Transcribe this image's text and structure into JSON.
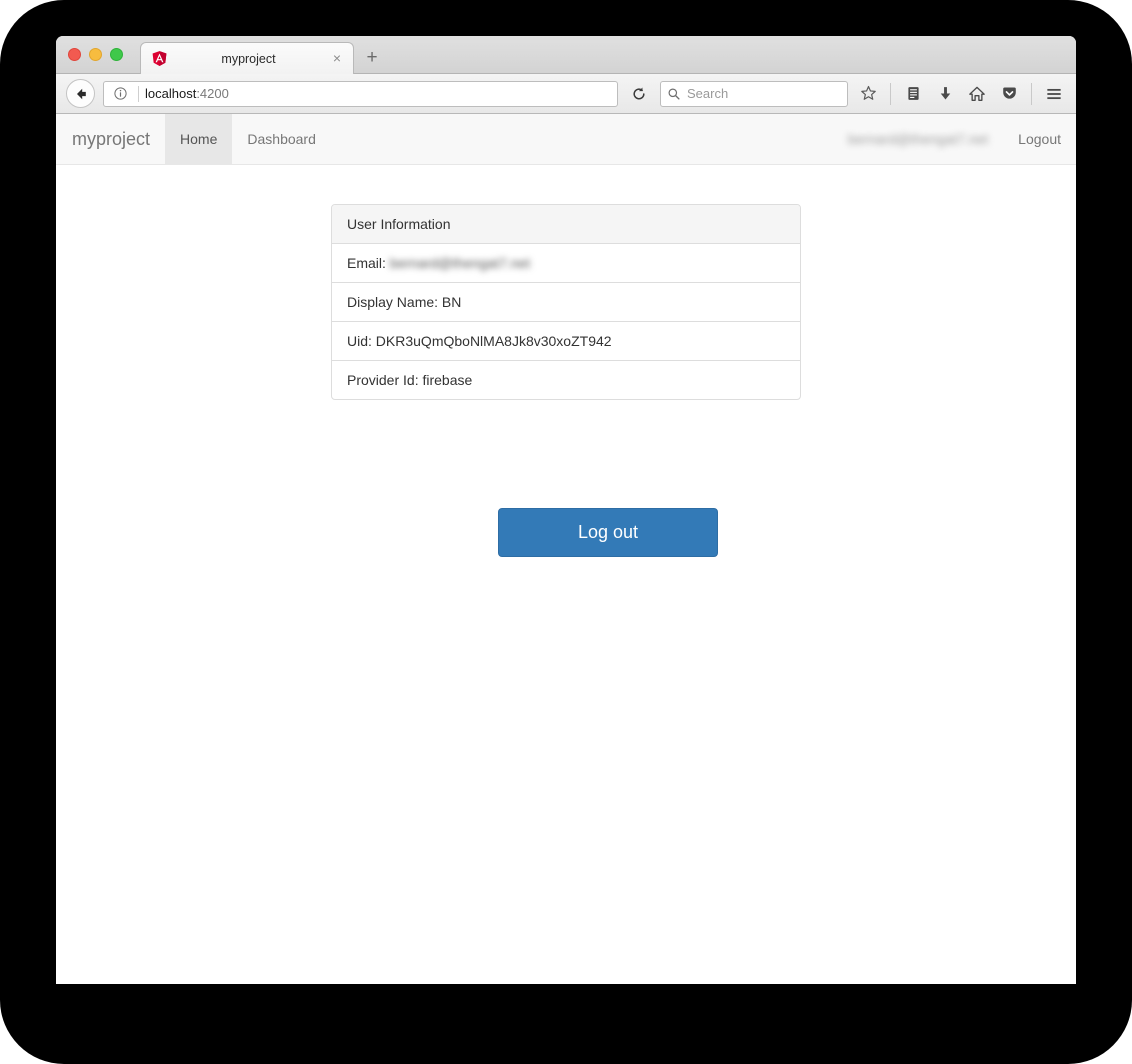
{
  "browser": {
    "traffic_lights": [
      "close",
      "minimize",
      "zoom"
    ],
    "tab": {
      "title": "myproject",
      "favicon": "angular-logo-icon",
      "close_label": "×"
    },
    "new_tab_label": "+",
    "back_label": "←",
    "url": {
      "host": "localhost",
      "port": ":4200"
    },
    "search": {
      "placeholder": "Search"
    },
    "toolbar_icons": [
      "bookmark-star-icon",
      "reader-list-icon",
      "downloads-icon",
      "home-icon",
      "pocket-icon",
      "menu-hamburger-icon"
    ]
  },
  "app": {
    "brand": "myproject",
    "nav_items": [
      {
        "label": "Home",
        "active": true
      },
      {
        "label": "Dashboard",
        "active": false
      }
    ],
    "navbar_user_email": "bernard@thengat7.net",
    "logout_link": "Logout",
    "panel": {
      "heading": "User Information",
      "rows": [
        {
          "label": "Email:",
          "value": "bernard@thengat7.net",
          "blurred": true
        },
        {
          "label": "Display Name:",
          "value": "BN",
          "blurred": false
        },
        {
          "label": "Uid:",
          "value": "DKR3uQmQboNlMA8Jk8v30xoZT942",
          "blurred": false
        },
        {
          "label": "Provider Id:",
          "value": "firebase",
          "blurred": false
        }
      ]
    },
    "logout_button": "Log out"
  },
  "colors": {
    "primary": "#337ab7",
    "primary_border": "#2e6da4",
    "navbar_bg": "#f8f8f8",
    "navbar_active": "#e7e7e7",
    "panel_heading_bg": "#f5f5f5",
    "panel_border": "#dddddd",
    "backdrop": "#000000"
  }
}
